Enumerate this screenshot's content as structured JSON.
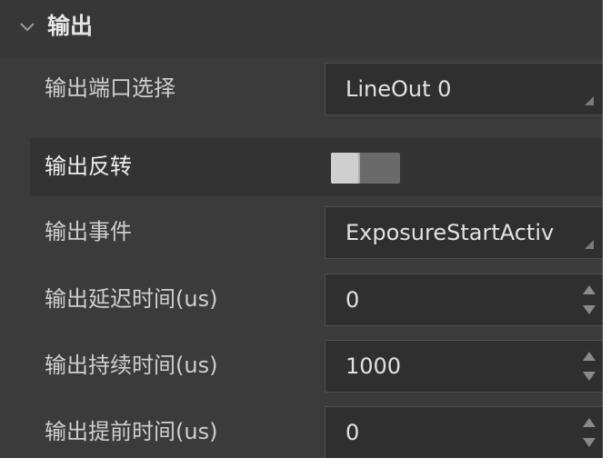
{
  "section": {
    "title": "输出",
    "expanded": true,
    "chevron_icon": "chevron-down-icon"
  },
  "properties": [
    {
      "label": "输出端口选择",
      "type": "combo",
      "value": "LineOut 0"
    },
    {
      "label": "输出反转",
      "type": "toggle",
      "checked": false
    },
    {
      "label": "输出事件",
      "type": "combo",
      "value": "ExposureStartActiv"
    },
    {
      "label": "输出延迟时间(us)",
      "type": "spinbox",
      "value": "0"
    },
    {
      "label": "输出持续时间(us)",
      "type": "spinbox",
      "value": "1000"
    },
    {
      "label": "输出提前时间(us)",
      "type": "spinbox",
      "value": "0"
    }
  ],
  "colors": {
    "panel_background": "#3b3b3b",
    "highlight_row": "#333333",
    "field_background": "#2f2f2f",
    "text": "#d8d8d8"
  }
}
